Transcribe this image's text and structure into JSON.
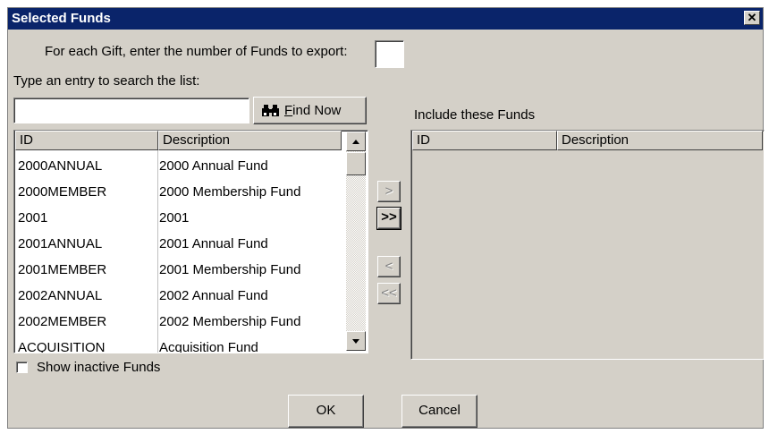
{
  "window": {
    "title": "Selected Funds",
    "close_glyph": "✕"
  },
  "export_prompt": {
    "label": "For each Gift, enter the number of Funds to export:",
    "value": ""
  },
  "search": {
    "label": "Type an entry to search the list:",
    "value": "",
    "find_button": "Find Now",
    "find_accel": "F",
    "find_rest": "ind Now"
  },
  "available": {
    "columns": [
      "ID",
      "Description"
    ],
    "rows": [
      {
        "id": "2000ANNUAL",
        "description": "2000 Annual Fund"
      },
      {
        "id": "2000MEMBER",
        "description": "2000 Membership Fund"
      },
      {
        "id": "2001",
        "description": "2001"
      },
      {
        "id": "2001ANNUAL",
        "description": "2001 Annual Fund"
      },
      {
        "id": "2001MEMBER",
        "description": "2001 Membership Fund"
      },
      {
        "id": "2002ANNUAL",
        "description": "2002 Annual Fund"
      },
      {
        "id": "2002MEMBER",
        "description": "2002 Membership Fund"
      },
      {
        "id": "ACQUISITION",
        "description": "Acquisition Fund"
      }
    ]
  },
  "included": {
    "label": "Include these Funds",
    "columns": [
      "ID",
      "Description"
    ],
    "rows": []
  },
  "transfer": {
    "add_one": ">",
    "add_all": ">>",
    "remove_one": "<",
    "remove_all": "<<"
  },
  "show_inactive": {
    "label": "Show inactive Funds",
    "checked": false
  },
  "footer": {
    "ok": "OK",
    "cancel": "Cancel"
  }
}
